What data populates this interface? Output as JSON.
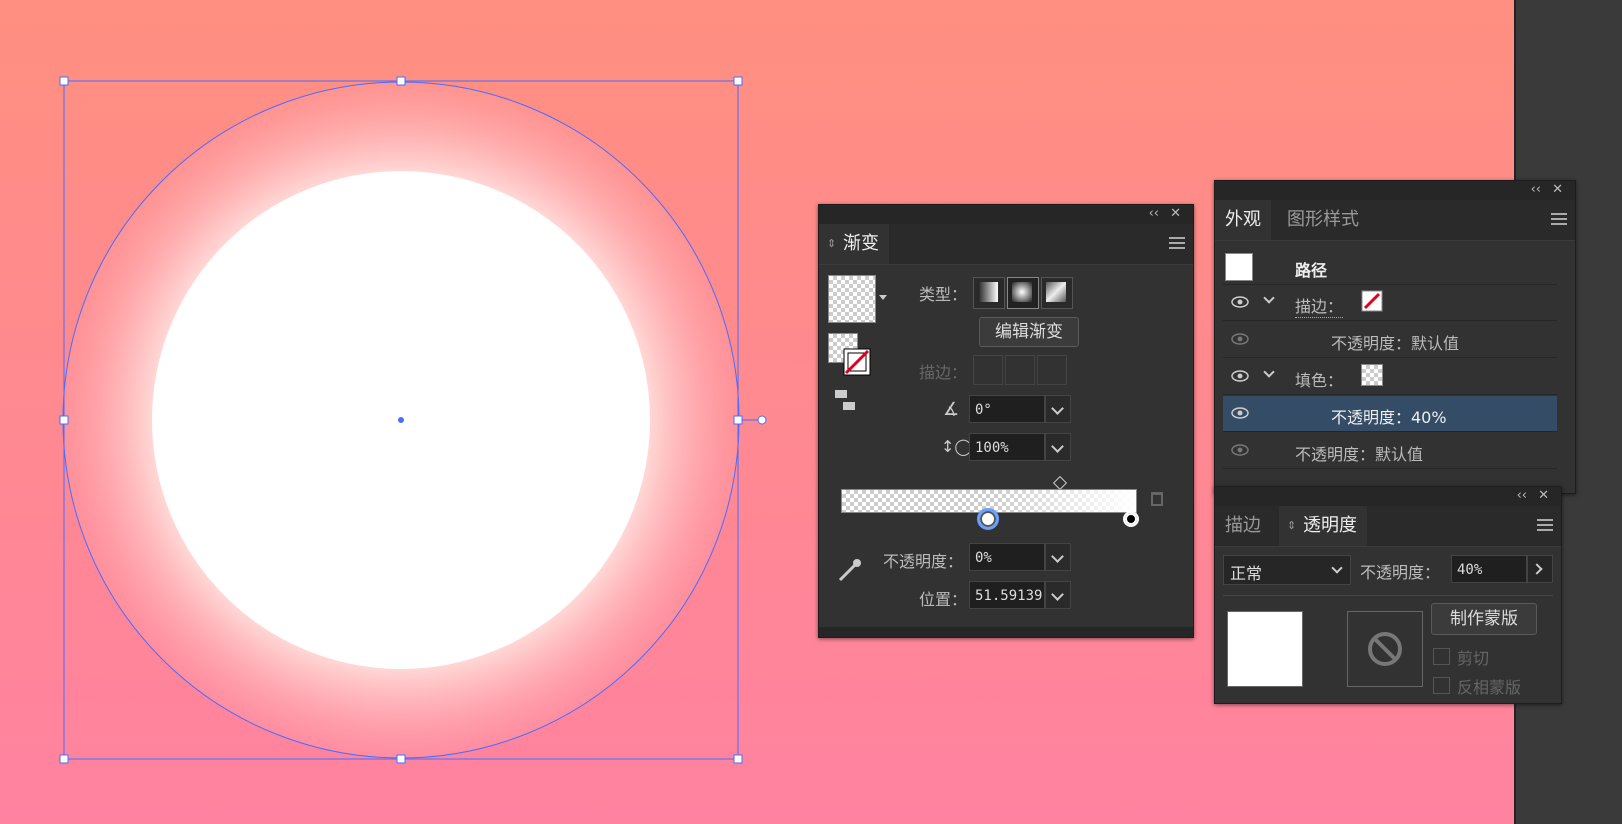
{
  "gradient_panel": {
    "title": "渐变",
    "type_label": "类型：",
    "edit_button": "编辑渐变",
    "stroke_label": "描边：",
    "angle_value": "0°",
    "aspect_value": "100%",
    "opacity_label": "不透明度：",
    "opacity_value": "0%",
    "position_label": "位置：",
    "position_value": "51.59139"
  },
  "appearance_panel": {
    "tabs": [
      "外观",
      "图形样式"
    ],
    "object": "路径",
    "stroke_label": "描边：",
    "stroke_opacity": "不透明度：默认值",
    "fill_label": "填色：",
    "fill_opacity": "不透明度：40%",
    "object_opacity": "不透明度：默认值"
  },
  "transparency_panel": {
    "tabs": [
      "描边",
      "透明度"
    ],
    "blend_mode": "正常",
    "opacity_label": "不透明度：",
    "opacity_value": "40%",
    "make_mask_button": "制作蒙版",
    "clip_label": "剪切",
    "invert_mask_label": "反相蒙版"
  },
  "colors": {
    "selection": "#4a6cff",
    "panel": "#323232",
    "highlight_row": "#344c66"
  },
  "icons": [
    "collapse-icon",
    "close-icon",
    "menu-icon",
    "eye-icon",
    "chevron-down-icon",
    "eyedropper-icon",
    "trash-icon",
    "no-entry-icon",
    "linear-gradient-icon",
    "radial-gradient-icon",
    "freeform-gradient-icon"
  ]
}
